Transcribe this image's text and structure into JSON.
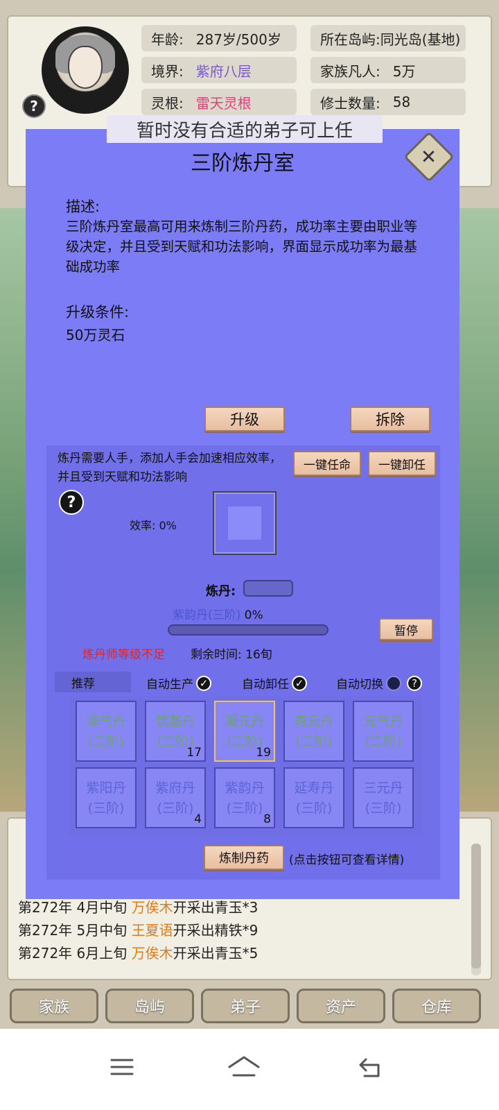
{
  "header": {
    "stats_left": [
      {
        "label": "年龄:",
        "value": "287岁/500岁"
      },
      {
        "label": "境界:",
        "value": "紫府八层"
      },
      {
        "label": "灵根:",
        "value": "雷天灵根"
      }
    ],
    "stats_right": [
      {
        "label": "所在岛屿:",
        "value": "同光岛(基地)"
      },
      {
        "label": "家族凡人:",
        "value": "5万"
      },
      {
        "label": "修士数量:",
        "value": "58"
      }
    ]
  },
  "toast": "暂时没有合适的弟子可上任",
  "modal": {
    "title": "三阶炼丹室",
    "desc_label": "描述:",
    "desc_text": "三阶炼丹室最高可用来炼制三阶丹药，成功率主要由职业等级决定，并且受到天赋和功法影响，界面显示成功率为最基础成功率",
    "upgrade_label": "升级条件:",
    "upgrade_cost": "50万灵石",
    "btn_upgrade": "升级",
    "btn_demolish": "拆除",
    "inner": {
      "note": "炼丹需要人手，添加人手会加速相应效率，并且受到天赋和功法影响",
      "btn_appoint": "一键任命",
      "btn_dismiss": "一键卸任",
      "efficiency": "效率: 0%",
      "danyao_label": "炼丹:",
      "progress_name": "紫韵丹(三阶)",
      "progress_pct": "0%",
      "progress_value": 0,
      "btn_pause": "暂停",
      "warning": "炼丹师等级不足",
      "remaining": "剩余时间: 16旬",
      "tab_recommend": "推荐",
      "opt_auto_produce": "自动生产",
      "opt_auto_dismiss": "自动卸任",
      "opt_auto_switch": "自动切换",
      "pills_row1": [
        {
          "name": "淬气丹",
          "tier": "(二阶)",
          "count": ""
        },
        {
          "name": "筑基丹",
          "tier": "(二阶)",
          "count": "17"
        },
        {
          "name": "凝元丹",
          "tier": "(二阶)",
          "count": "19"
        },
        {
          "name": "寿元丹",
          "tier": "(二阶)",
          "count": ""
        },
        {
          "name": "元气丹",
          "tier": "(二阶)",
          "count": ""
        }
      ],
      "pills_row2": [
        {
          "name": "紫阳丹",
          "tier": "(三阶)",
          "count": ""
        },
        {
          "name": "紫府丹",
          "tier": "(三阶)",
          "count": "4"
        },
        {
          "name": "紫韵丹",
          "tier": "(三阶)",
          "count": "8"
        },
        {
          "name": "延寿丹",
          "tier": "(三阶)",
          "count": ""
        },
        {
          "name": "三元丹",
          "tier": "(三阶)",
          "count": ""
        }
      ],
      "btn_make": "炼制丹药",
      "make_hint": "(点击按钮可查看详情)"
    }
  },
  "log": [
    {
      "year": "第272年",
      "time": "4月中旬",
      "name": "万俟木",
      "action": "开采出青玉*3"
    },
    {
      "year": "第272年",
      "time": "5月中旬",
      "name": "王夏语",
      "action": "开采出精铁*9"
    },
    {
      "year": "第272年",
      "time": "6月上旬",
      "name": "万俟木",
      "action": "开采出青玉*5"
    }
  ],
  "nav": [
    "家族",
    "岛屿",
    "弟子",
    "资产",
    "仓库"
  ],
  "colors": {
    "modal_bg": "#7d7cf7",
    "accent_green": "#6aa66a",
    "accent_blue": "#5b64d8",
    "warning": "#e0242c",
    "name_orange": "#e07a1c"
  }
}
